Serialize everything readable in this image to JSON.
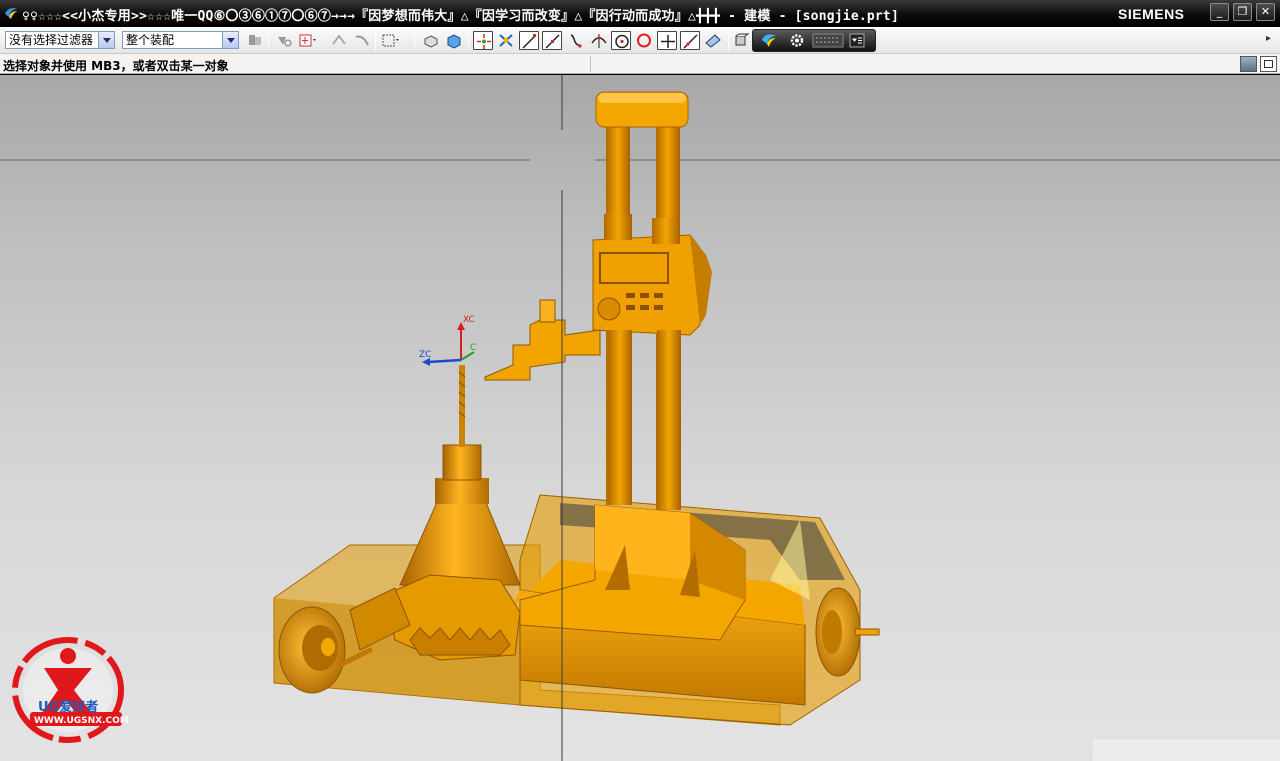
{
  "window": {
    "title": "♀♀☆☆☆<<小杰专用>>☆☆☆唯一QQ⑥〇③⑥①⑦〇⑥⑦→→→『因梦想而伟大』△『因学习而改变』△『因行动而成功』△╋╋╋ - 建模 - [songjie.prt]",
    "brand": "SIEMENS",
    "minimize_label": "_",
    "restore_label": "❐",
    "close_label": "✕"
  },
  "toolbar": {
    "type_filter": {
      "selected": "没有选择过滤器"
    },
    "scope_filter": {
      "selected": "整个装配"
    },
    "more_label": "▸"
  },
  "cue_line": {
    "text": "选择对象并使用 MB3，或者双击某一对象"
  },
  "viewport": {
    "wcs_labels": {
      "x": "XC",
      "y": "C",
      "z": "ZC"
    },
    "watermark": {
      "brand": "UG爱好者",
      "url": "WWW.UGSNX.COM"
    }
  },
  "colors": {
    "model": "#f0a000",
    "model_shadow": "#b86f00",
    "model_highlight": "#ffc63a",
    "background_top": "#a7a7a7",
    "background_bottom": "#e3e3e3"
  }
}
